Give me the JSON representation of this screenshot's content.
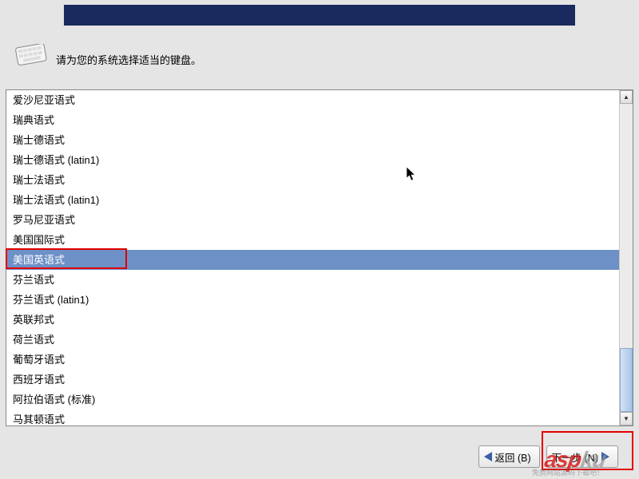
{
  "prompt": "请为您的系统选择适当的键盘。",
  "list": {
    "items": [
      "爱沙尼亚语式",
      "瑞典语式",
      "瑞士德语式",
      "瑞士德语式 (latin1)",
      "瑞士法语式",
      "瑞士法语式 (latin1)",
      "罗马尼亚语式",
      "美国国际式",
      "美国英语式",
      "芬兰语式",
      "芬兰语式 (latin1)",
      "英联邦式",
      "荷兰语式",
      "葡萄牙语式",
      "西班牙语式",
      "阿拉伯语式 (标准)",
      "马其顿语式"
    ],
    "selected_index": 8
  },
  "buttons": {
    "back": "返回 (B)",
    "next": "下一步 (N)"
  },
  "watermark": {
    "main_red": "asp",
    "main_gray": "ku",
    "sub": "免费网站源码下载吧！"
  }
}
